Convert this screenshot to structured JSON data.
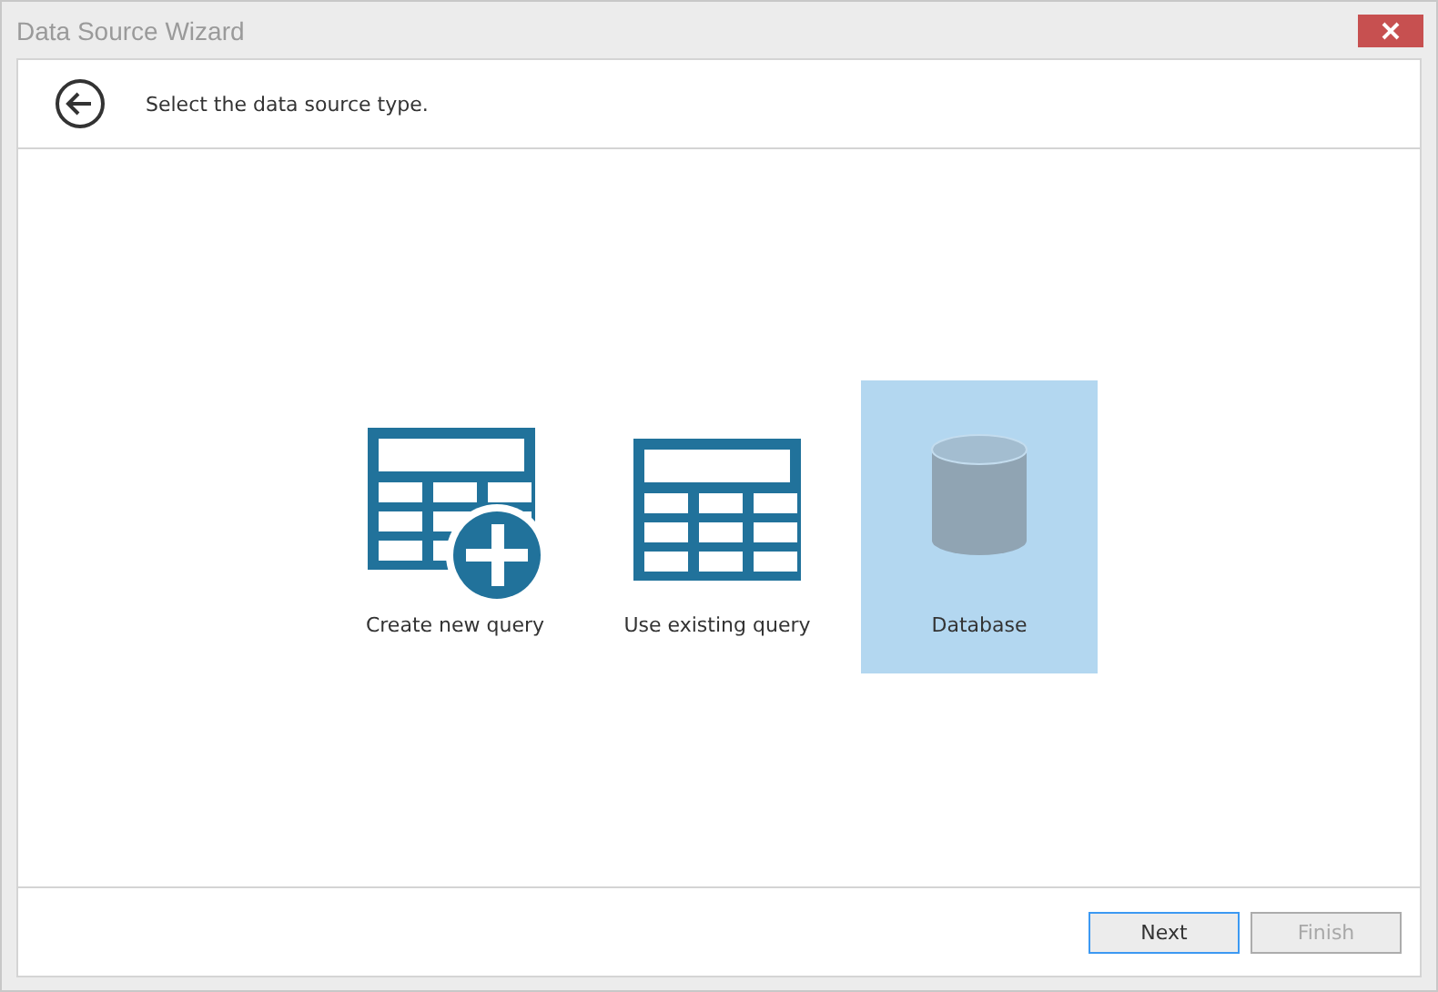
{
  "window": {
    "title": "Data Source Wizard"
  },
  "header": {
    "instruction": "Select the data source type."
  },
  "options": [
    {
      "kind": "new-query",
      "label": "Create new query",
      "selected": false
    },
    {
      "kind": "existing-query",
      "label": "Use existing query",
      "selected": false
    },
    {
      "kind": "database",
      "label": "Database",
      "selected": true
    }
  ],
  "buttons": [
    {
      "label": "Next",
      "disabled": false,
      "focused": true
    },
    {
      "label": "Finish",
      "disabled": true,
      "focused": false
    }
  ]
}
